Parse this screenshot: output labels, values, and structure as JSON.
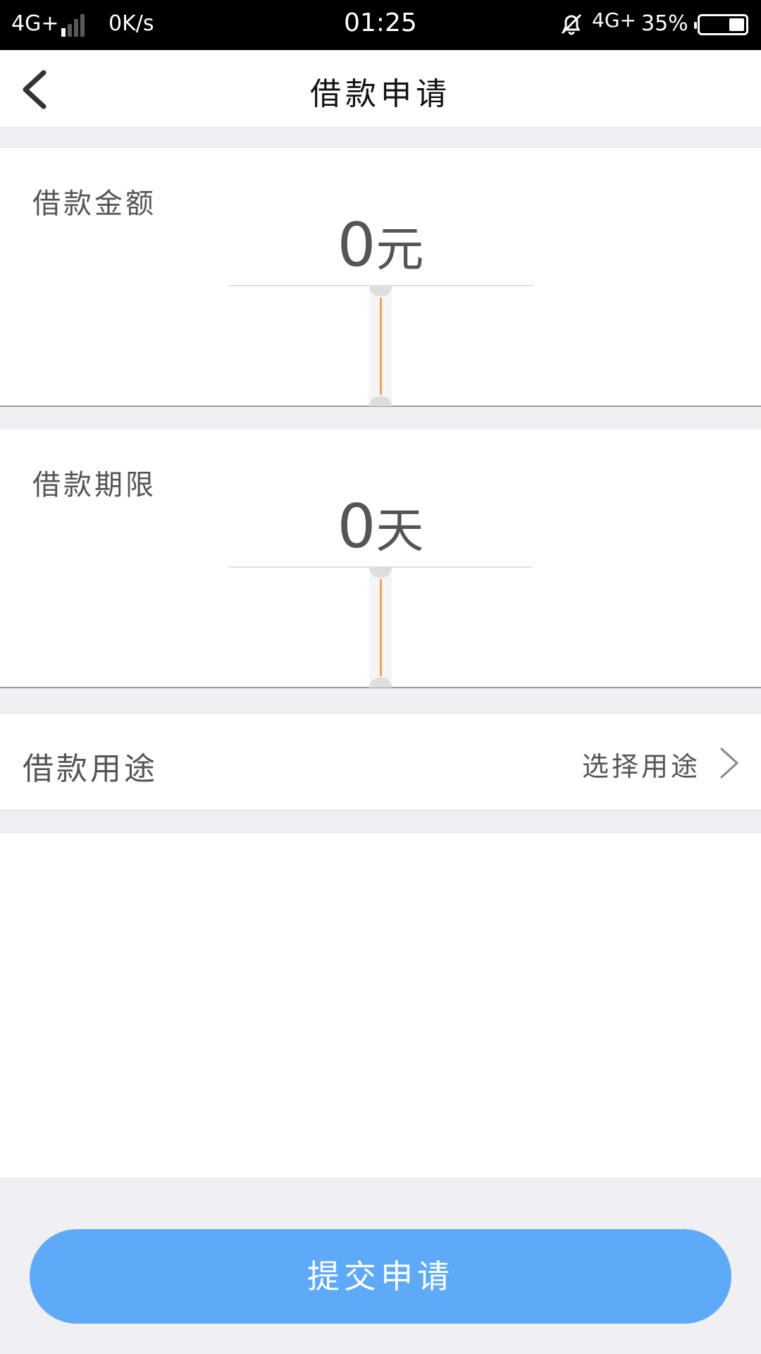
{
  "status_bar": {
    "network_left": "4G+",
    "speed": "0K/s",
    "time": "01:25",
    "network_right": "4G+",
    "battery_percent": "35%",
    "battery_level": 0.35,
    "icons": [
      "signal-icon",
      "alarm-off-icon",
      "battery-icon"
    ]
  },
  "header": {
    "back_icon": "chevron-left-icon",
    "title": "借款申请"
  },
  "amount": {
    "label": "借款金额",
    "value": "0",
    "unit": "元"
  },
  "term": {
    "label": "借款期限",
    "value": "0",
    "unit": "天"
  },
  "purpose": {
    "label": "借款用途",
    "placeholder": "选择用途",
    "icon": "chevron-right-icon"
  },
  "submit": {
    "label": "提交申请",
    "color": "#5eaaf8"
  },
  "colors": {
    "accent_indicator": "#f5a05a",
    "background": "#f0f0f4"
  }
}
